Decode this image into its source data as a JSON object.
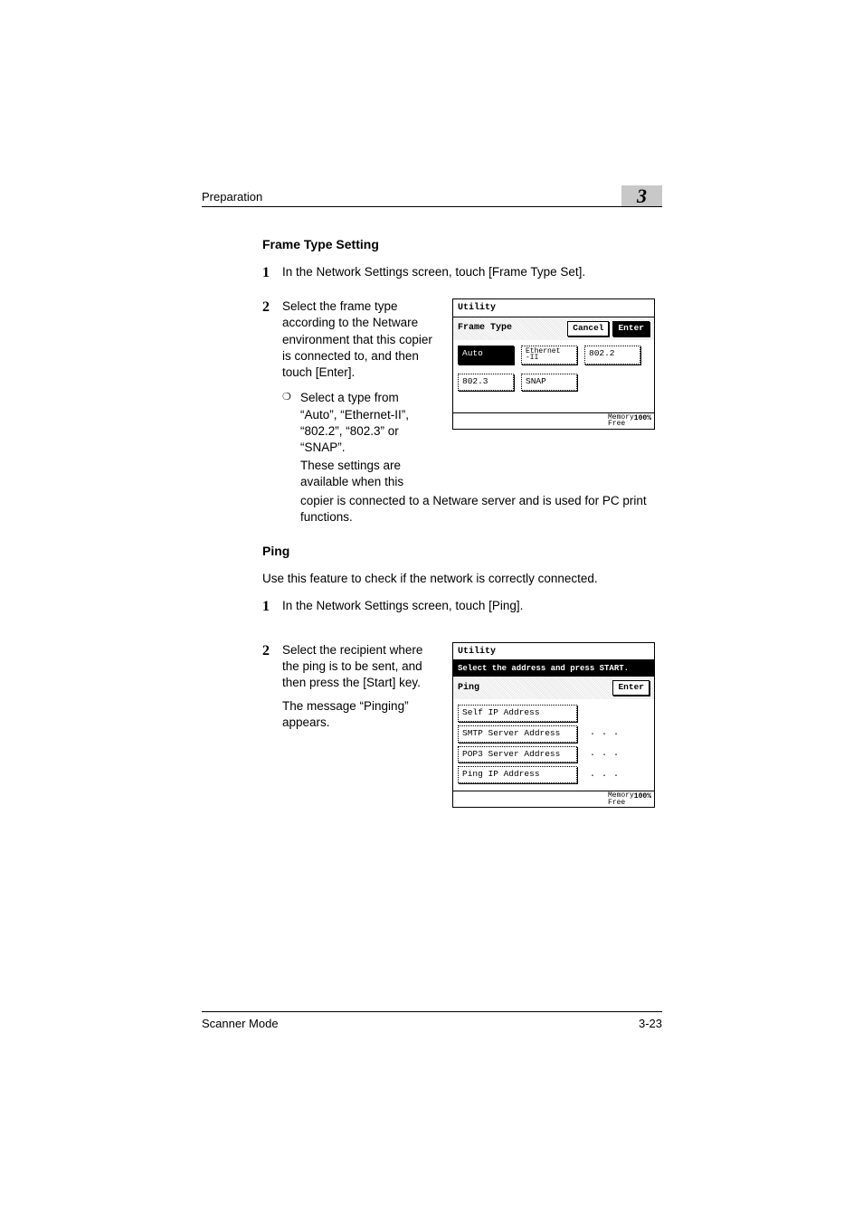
{
  "header": {
    "section_label": "Preparation",
    "chapter_number": "3"
  },
  "frame_type": {
    "heading": "Frame Type Setting",
    "step1": "In the Network Settings screen, touch [Frame Type Set].",
    "step2_main": "Select the frame type according to the Netware environment that this copier is connected to, and then touch [Enter].",
    "step2_sub_a": "Select a type from “Auto”, “Ethernet-II”, “802.2”, “802.3” or “SNAP”.",
    "step2_sub_b": "These settings are available when this",
    "step2_tail": "copier is connected to a Netware server and is used for PC print functions."
  },
  "panel1": {
    "title": "Utility",
    "row_label": "Frame Type",
    "cancel": "Cancel",
    "enter": "Enter",
    "auto": "Auto",
    "eth2_l1": "Ethernet",
    "eth2_l2": "-II",
    "b802_2": "802.2",
    "b802_3": "802.3",
    "snap": "SNAP",
    "mem_l1": "Memory",
    "mem_l2": "Free",
    "mem_pct": "100%"
  },
  "ping": {
    "heading": "Ping",
    "intro": "Use this feature to check if the network is correctly connected.",
    "step1": "In the Network Settings screen, touch [Ping].",
    "step2_main": "Select the recipient where the ping is to be sent, and then press the [Start] key.",
    "step2_note": "The message “Pinging” appears."
  },
  "panel2": {
    "title": "Utility",
    "banner": "Select the address and press START.",
    "row_label": "Ping",
    "enter": "Enter",
    "r1": "Self IP Address",
    "r2": "SMTP Server Address",
    "r3": "POP3 Server Address",
    "r4": "Ping IP Address",
    "mem_l1": "Memory",
    "mem_l2": "Free",
    "mem_pct": "100%"
  },
  "footer": {
    "left": "Scanner Mode",
    "right": "3-23"
  }
}
